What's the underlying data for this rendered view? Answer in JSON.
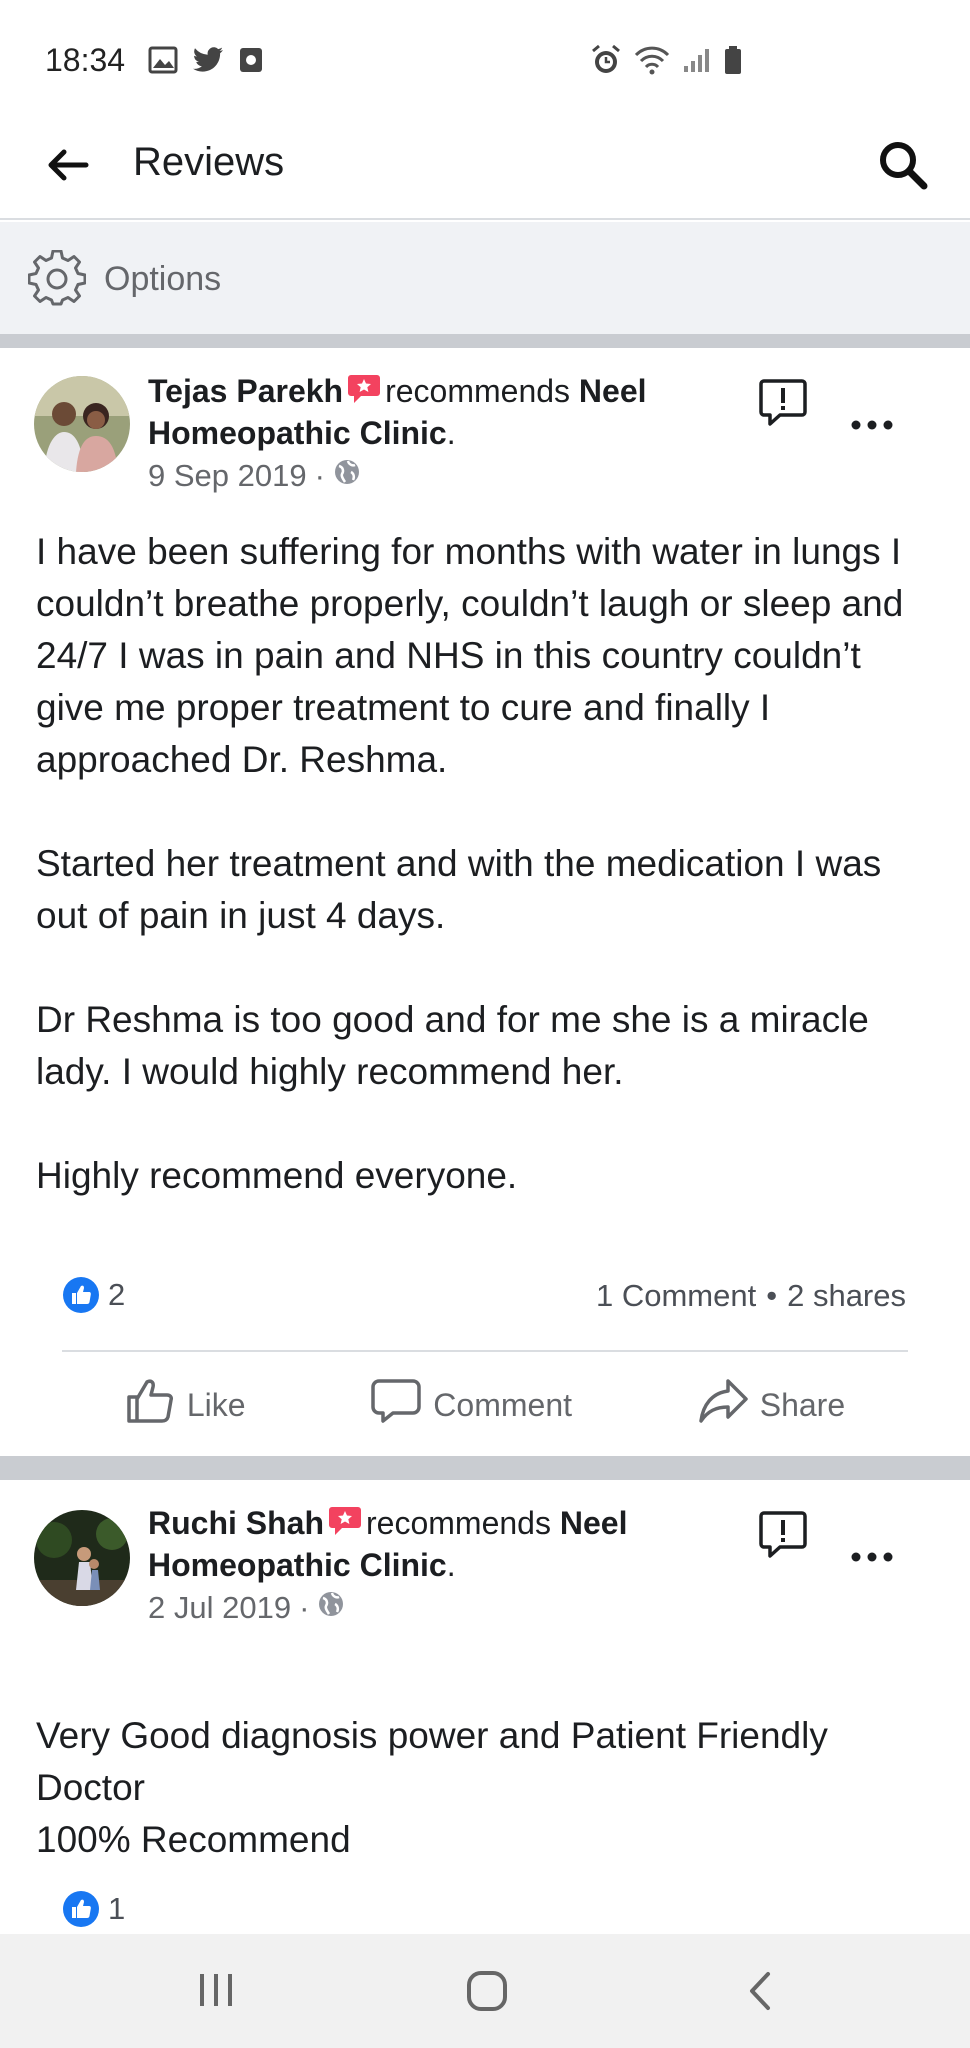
{
  "status_bar": {
    "time": "18:34",
    "left_icons": [
      "gallery-icon",
      "twitter-icon",
      "screen-record-icon"
    ],
    "right_icons": [
      "alarm-icon",
      "wifi-icon",
      "signal-icon",
      "battery-icon"
    ]
  },
  "app_bar": {
    "title": "Reviews",
    "back_icon": "arrow-left-icon",
    "search_icon": "search-icon"
  },
  "options_bar": {
    "label": "Options",
    "icon": "gear-icon"
  },
  "posts": [
    {
      "author": "Tejas Parekh",
      "verb": "recommends",
      "page": "Neel Homeopathic Clinic",
      "punct": ".",
      "date": "9 Sep 2019",
      "separator": "·",
      "paragraphs": [
        "I have been suffering for months with water in lungs I couldn’t breathe properly, couldn’t laugh or sleep and 24/7 I was in pain and NHS in this country couldn’t give me proper treatment to cure and finally I approached Dr. Reshma.",
        "Started her treatment and with the medication I was out of pain in just 4 days.",
        "Dr Reshma is too good and for me she is a miracle lady. I would highly recommend her.",
        "Highly recommend everyone."
      ],
      "like_count": "2",
      "comments": "1 Comment",
      "dot": "•",
      "shares": "2 shares",
      "actions": {
        "like": "Like",
        "comment": "Comment",
        "share": "Share"
      }
    },
    {
      "author": "Ruchi Shah",
      "verb": "recommends",
      "page": "Neel Homeopathic Clinic",
      "punct": ".",
      "date": "2 Jul 2019",
      "separator": "·",
      "paragraphs": [
        "Very Good diagnosis power and Patient Friendly Doctor\n100% Recommend"
      ],
      "like_count": "1"
    }
  ],
  "colors": {
    "like_blue": "#1877f2",
    "recommend_red": "#f3425f",
    "secondary_text": "#65676b",
    "separator": "#c9ccd1"
  },
  "nav_bar": {
    "icons": [
      "recent-apps-icon",
      "home-icon",
      "back-icon"
    ]
  }
}
